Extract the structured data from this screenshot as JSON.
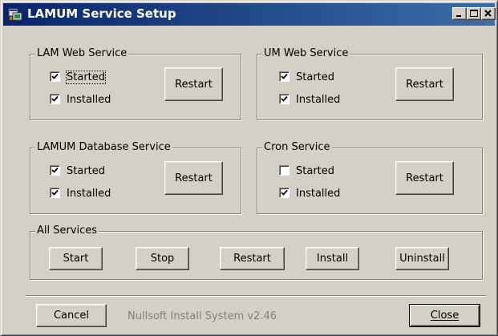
{
  "window": {
    "title": "LAMUM Service Setup",
    "icon": "installer-icon",
    "controls": {
      "minimize": "_",
      "maximize": "□",
      "close": "×"
    }
  },
  "groups": {
    "lam": {
      "label": "LAM Web Service",
      "started_label": "Started",
      "started": true,
      "installed_label": "Installed",
      "installed": true,
      "restart_label": "Restart"
    },
    "um": {
      "label": "UM Web Service",
      "started_label": "Started",
      "started": true,
      "installed_label": "Installed",
      "installed": true,
      "restart_label": "Restart"
    },
    "db": {
      "label": "LAMUM Database Service",
      "started_label": "Started",
      "started": true,
      "installed_label": "Installed",
      "installed": true,
      "restart_label": "Restart"
    },
    "cron": {
      "label": "Cron Service",
      "started_label": "Started",
      "started": false,
      "installed_label": "Installed",
      "installed": true,
      "restart_label": "Restart"
    },
    "all": {
      "label": "All Services",
      "start_label": "Start",
      "stop_label": "Stop",
      "restart_label": "Restart",
      "install_label": "Install",
      "uninstall_label": "Uninstall"
    }
  },
  "footer": {
    "cancel_label": "Cancel",
    "branding": "Nullsoft Install System v2.46",
    "close_label": "Close"
  },
  "colors": {
    "face": "#d4d0c8",
    "title_start": "#0a246a",
    "title_end": "#3a6ea5"
  }
}
